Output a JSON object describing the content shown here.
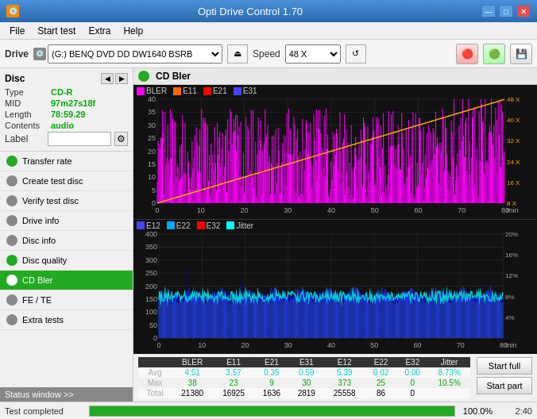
{
  "app": {
    "title": "Opti Drive Control 1.70",
    "icon": "💿"
  },
  "window_controls": {
    "minimize": "—",
    "maximize": "□",
    "close": "✕"
  },
  "menu": {
    "items": [
      "File",
      "Start test",
      "Extra",
      "Help"
    ]
  },
  "toolbar": {
    "drive_label": "Drive",
    "drive_value": "(G:)  BENQ DVD DD DW1640 BSRB",
    "eject_icon": "⏏",
    "speed_label": "Speed",
    "speed_value": "48 X",
    "refresh_icon": "↺",
    "colors": [
      "🔴",
      "🟢",
      "💾"
    ]
  },
  "disc": {
    "section_label": "Disc",
    "type_key": "Type",
    "type_val": "CD-R",
    "mid_key": "MID",
    "mid_val": "97m27s18f",
    "length_key": "Length",
    "length_val": "78:59.29",
    "contents_key": "Contents",
    "contents_val": "audio",
    "label_key": "Label",
    "label_val": ""
  },
  "nav": {
    "items": [
      {
        "id": "transfer-rate",
        "label": "Transfer rate",
        "active": false
      },
      {
        "id": "create-test-disc",
        "label": "Create test disc",
        "active": false
      },
      {
        "id": "verify-test-disc",
        "label": "Verify test disc",
        "active": false
      },
      {
        "id": "drive-info",
        "label": "Drive info",
        "active": false
      },
      {
        "id": "disc-info",
        "label": "Disc info",
        "active": false
      },
      {
        "id": "disc-quality",
        "label": "Disc quality",
        "active": false
      },
      {
        "id": "cd-bler",
        "label": "CD Bler",
        "active": true
      },
      {
        "id": "fe-te",
        "label": "FE / TE",
        "active": false
      },
      {
        "id": "extra-tests",
        "label": "Extra tests",
        "active": false
      }
    ]
  },
  "status_window": {
    "label": "Status window >>"
  },
  "chart": {
    "title": "CD Bler",
    "top": {
      "legend": [
        {
          "label": "BLER",
          "color": "#ff00ff"
        },
        {
          "label": "E11",
          "color": "#ff6600"
        },
        {
          "label": "E21",
          "color": "#ff0000"
        },
        {
          "label": "E31",
          "color": "#0000ff"
        }
      ],
      "y_max": 40,
      "x_max": 80,
      "right_labels": [
        "48 X",
        "40 X",
        "32 X",
        "24 X",
        "16 X",
        "8 X"
      ]
    },
    "bottom": {
      "legend": [
        {
          "label": "E12",
          "color": "#0000ff"
        },
        {
          "label": "E22",
          "color": "#00aaff"
        },
        {
          "label": "E32",
          "color": "#ff0000"
        },
        {
          "label": "Jitter",
          "color": "#00ffff"
        }
      ],
      "y_max": 400,
      "x_max": 80,
      "right_labels": [
        "20%",
        "16%",
        "12%",
        "8%",
        "4%"
      ]
    }
  },
  "stats": {
    "headers": [
      "BLER",
      "E11",
      "E21",
      "E31",
      "E12",
      "E22",
      "E32",
      "Jitter"
    ],
    "rows": [
      {
        "label": "Avg",
        "values": [
          "4.51",
          "3.57",
          "0.35",
          "0.59",
          "5.39",
          "0.02",
          "0.00",
          "8.73%"
        ]
      },
      {
        "label": "Max",
        "values": [
          "38",
          "23",
          "9",
          "30",
          "373",
          "25",
          "0",
          "10.5%"
        ]
      },
      {
        "label": "Total",
        "values": [
          "21380",
          "16925",
          "1636",
          "2819",
          "25558",
          "86",
          "0",
          ""
        ]
      }
    ]
  },
  "buttons": {
    "start_full": "Start full",
    "start_part": "Start part"
  },
  "status_bar": {
    "text": "Test completed",
    "progress": 100,
    "progress_text": "100.0%",
    "time": "2:40"
  }
}
